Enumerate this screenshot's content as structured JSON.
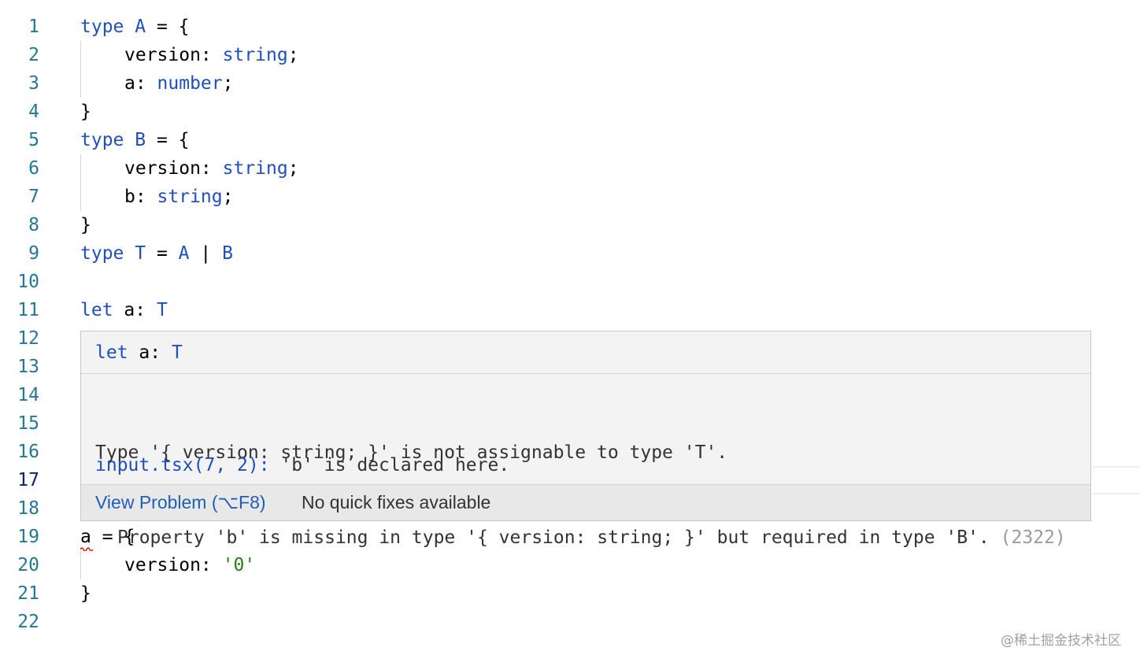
{
  "lines": [
    {
      "n": "1",
      "tokens": [
        [
          "kw",
          "type"
        ],
        [
          "plain",
          " "
        ],
        [
          "tp",
          "A"
        ],
        [
          "plain",
          " = {"
        ]
      ]
    },
    {
      "n": "2",
      "indent": true,
      "tokens": [
        [
          "plain",
          "version: "
        ],
        [
          "tp",
          "string"
        ],
        [
          "plain",
          ";"
        ]
      ]
    },
    {
      "n": "3",
      "indent": true,
      "tokens": [
        [
          "plain",
          "a: "
        ],
        [
          "tp",
          "number"
        ],
        [
          "plain",
          ";"
        ]
      ]
    },
    {
      "n": "4",
      "tokens": [
        [
          "plain",
          "}"
        ]
      ]
    },
    {
      "n": "5",
      "tokens": [
        [
          "kw",
          "type"
        ],
        [
          "plain",
          " "
        ],
        [
          "tp",
          "B"
        ],
        [
          "plain",
          " = {"
        ]
      ]
    },
    {
      "n": "6",
      "indent": true,
      "tokens": [
        [
          "plain",
          "version: "
        ],
        [
          "tp",
          "string"
        ],
        [
          "plain",
          ";"
        ]
      ]
    },
    {
      "n": "7",
      "indent": true,
      "tokens": [
        [
          "plain",
          "b: "
        ],
        [
          "tp",
          "string"
        ],
        [
          "plain",
          ";"
        ]
      ]
    },
    {
      "n": "8",
      "tokens": [
        [
          "plain",
          "}"
        ]
      ]
    },
    {
      "n": "9",
      "tokens": [
        [
          "kw",
          "type"
        ],
        [
          "plain",
          " "
        ],
        [
          "tp",
          "T"
        ],
        [
          "plain",
          " = "
        ],
        [
          "tp",
          "A"
        ],
        [
          "plain",
          " | "
        ],
        [
          "tp",
          "B"
        ]
      ]
    },
    {
      "n": "10",
      "tokens": []
    },
    {
      "n": "11",
      "tokens": [
        [
          "kw",
          "let"
        ],
        [
          "plain",
          " a: "
        ],
        [
          "tp",
          "T"
        ]
      ]
    },
    {
      "n": "12",
      "tokens": []
    },
    {
      "n": "13",
      "tokens": []
    },
    {
      "n": "14",
      "tokens": []
    },
    {
      "n": "15",
      "tokens": []
    },
    {
      "n": "16",
      "tokens": []
    },
    {
      "n": "17",
      "active": true,
      "tokens": []
    },
    {
      "n": "18",
      "tokens": []
    },
    {
      "n": "19",
      "tokens": [
        [
          "plain",
          "a = {"
        ]
      ]
    },
    {
      "n": "20",
      "indent": true,
      "tokens": [
        [
          "plain",
          "version: "
        ],
        [
          "str",
          "'0'"
        ]
      ]
    },
    {
      "n": "21",
      "tokens": [
        [
          "plain",
          "}"
        ]
      ]
    },
    {
      "n": "22",
      "tokens": []
    }
  ],
  "hover": {
    "signature": [
      [
        "kw",
        "let"
      ],
      [
        "plain",
        " a: "
      ],
      [
        "tp",
        "T"
      ]
    ],
    "message_line1": "Type '{ version: string; }' is not assignable to type 'T'.",
    "message_line2": "Property 'b' is missing in type '{ version: string; }' but required in type 'B'.",
    "error_code": "(2322)",
    "related_location": "input.tsx(7, 2):",
    "related_message": " 'b' is declared here.",
    "view_problem_label": "View Problem (⌥F8)",
    "no_fixes_label": "No quick fixes available"
  },
  "watermark": "@稀土掘金技术社区",
  "colors": {
    "keyword": "#1f4fbf",
    "string": "#267f16",
    "line_number": "#237893",
    "error_squiggle": "#e51400",
    "link": "#1f5fb5"
  }
}
